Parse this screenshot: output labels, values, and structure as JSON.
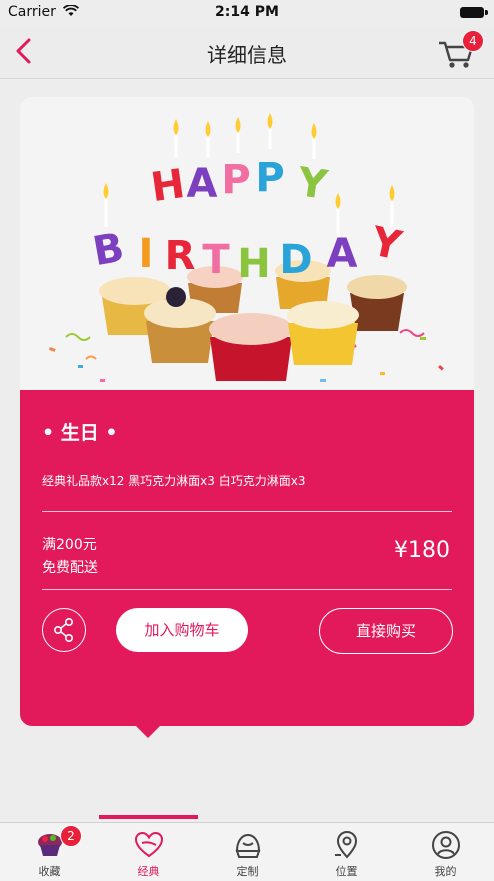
{
  "status_bar": {
    "carrier": "Carrier",
    "time": "2:14 PM"
  },
  "nav": {
    "title": "详细信息",
    "cart_count": "4"
  },
  "product": {
    "name": "• 生日 •",
    "description": "经典礼品款x12 黑巧克力淋面x3 白巧克力淋面x3",
    "promo_line1": "满200元",
    "promo_line2": "免费配送",
    "price": "¥180",
    "add_to_cart_label": "加入购物车",
    "buy_now_label": "直接购买"
  },
  "tabs": [
    {
      "label": "收藏",
      "badge": "2",
      "icon": "cupcake-icon"
    },
    {
      "label": "经典",
      "icon": "heart-icon"
    },
    {
      "label": "定制",
      "icon": "cake-icon"
    },
    {
      "label": "位置",
      "icon": "location-pin-icon"
    },
    {
      "label": "我的",
      "icon": "user-icon"
    }
  ],
  "colors": {
    "accent": "#e2195b",
    "badge": "#e8203a"
  }
}
